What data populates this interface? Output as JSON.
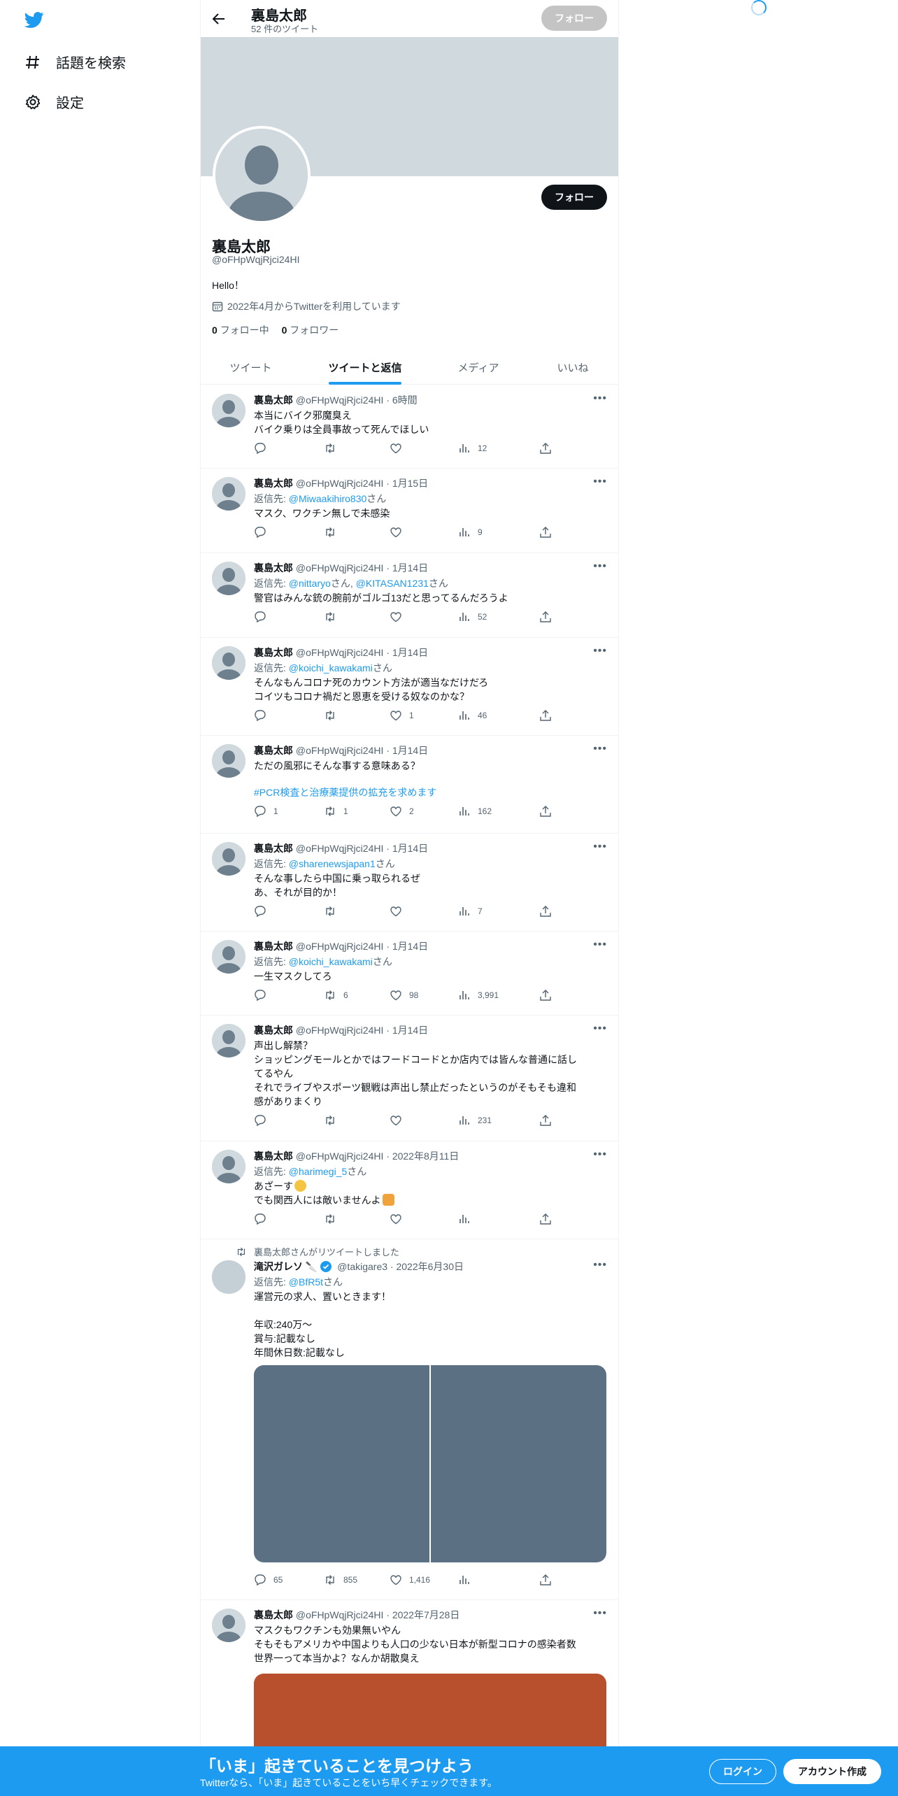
{
  "nav": {
    "items": [
      {
        "label": "話題を検索",
        "icon": "hashtag-icon"
      },
      {
        "label": "設定",
        "icon": "gear-icon"
      }
    ]
  },
  "topbar": {
    "name": "裏島太郎",
    "tweet_count": "52 件のツイート",
    "follow_label": "フォロー"
  },
  "profile": {
    "name": "裏島太郎",
    "handle": "@oFHpWqjRjci24HI",
    "bio": "Hello！",
    "joined": "2022年4月からTwitterを利用しています",
    "following_count": "0",
    "following_label": "フォロー中",
    "followers_count": "0",
    "followers_label": "フォロワー",
    "follow_label": "フォロー"
  },
  "tabs": [
    {
      "label": "ツイート"
    },
    {
      "label": "ツイートと返信"
    },
    {
      "label": "メディア"
    },
    {
      "label": "いいね"
    }
  ],
  "tweets": [
    {
      "name": "裏島太郎",
      "handle": "@oFHpWqjRjci24HI",
      "time": "6時間",
      "lines": [
        "本当にバイク邪魔臭え",
        "バイク乗りは全員事故って死んでほしい"
      ],
      "replies": "",
      "retweets": "",
      "likes": "",
      "views": "12"
    },
    {
      "name": "裏島太郎",
      "handle": "@oFHpWqjRjci24HI",
      "time": "1月15日",
      "reply_prefix": "返信先: ",
      "reply_to": "@Miwaakihiro830",
      "reply_suffix": "さん",
      "lines": [
        "マスク、ワクチン無しで未感染"
      ],
      "views": "9"
    },
    {
      "name": "裏島太郎",
      "handle": "@oFHpWqjRjci24HI",
      "time": "1月14日",
      "reply_prefix": "返信先: ",
      "reply_to": "@nittaryo",
      "reply_mid": "さん, ",
      "reply_to2": "@KITASAN1231",
      "reply_suffix": "さん",
      "lines": [
        "警官はみんな銃の腕前がゴルゴ13だと思ってるんだろうよ"
      ],
      "views": "52"
    },
    {
      "name": "裏島太郎",
      "handle": "@oFHpWqjRjci24HI",
      "time": "1月14日",
      "reply_prefix": "返信先: ",
      "reply_to": "@koichi_kawakami",
      "reply_suffix": "さん",
      "lines": [
        "そんなもんコロナ死のカウント方法が適当なだけだろ",
        "コイツもコロナ禍だと恩恵を受ける奴なのかな？"
      ],
      "likes": "1",
      "views": "46"
    },
    {
      "name": "裏島太郎",
      "handle": "@oFHpWqjRjci24HI",
      "time": "1月14日",
      "lines": [
        "ただの風邪にそんな事する意味ある？"
      ],
      "hashtag": "#PCR検査と治療薬提供の拡充を求めます",
      "replies": "1",
      "retweets": "1",
      "likes": "2",
      "views": "162"
    },
    {
      "name": "裏島太郎",
      "handle": "@oFHpWqjRjci24HI",
      "time": "1月14日",
      "reply_prefix": "返信先: ",
      "reply_to": "@sharenewsjapan1",
      "reply_suffix": "さん",
      "lines": [
        "そんな事したら中国に乗っ取られるぜ",
        "あ、それが目的か！"
      ],
      "views": "7"
    },
    {
      "name": "裏島太郎",
      "handle": "@oFHpWqjRjci24HI",
      "time": "1月14日",
      "reply_prefix": "返信先: ",
      "reply_to": "@koichi_kawakami",
      "reply_suffix": "さん",
      "lines": [
        "一生マスクしてろ"
      ],
      "retweets": "6",
      "likes": "98",
      "views": "3,991"
    },
    {
      "name": "裏島太郎",
      "handle": "@oFHpWqjRjci24HI",
      "time": "1月14日",
      "lines": [
        "声出し解禁？",
        "ショッピングモールとかではフードコードとか店内では皆んな普通に話し",
        "てるやん",
        "それでライブやスポーツ観戦は声出し禁止だったというのがそもそも違和",
        "感がありまくり"
      ],
      "views": "231"
    },
    {
      "name": "裏島太郎",
      "handle": "@oFHpWqjRjci24HI",
      "time": "2022年8月11日",
      "reply_prefix": "返信先: ",
      "reply_to": "@harimegi_5",
      "reply_suffix": "さん",
      "lines": [
        "あざーす",
        "でも関西人には敵いませんよ"
      ],
      "views": ""
    },
    {
      "retweet_label": "裏島太郎さんがリツイートしました",
      "name": "滝沢ガレソ",
      "handle": "@takigare3",
      "time": "2022年6月30日",
      "reply_prefix": "返信先: ",
      "reply_to": "@BfR5t",
      "reply_suffix": "さん",
      "lines": [
        "運営元の求人、置いときます！",
        "",
        "年収:240万〜",
        "賞与:記載なし",
        "年間休日数:記載なし"
      ],
      "replies": "65",
      "retweets": "855",
      "likes": "1,416",
      "views": ""
    },
    {
      "name": "裏島太郎",
      "handle": "@oFHpWqjRjci24HI",
      "time": "2022年7月28日",
      "lines": [
        "マスクもワクチンも効果無いやん",
        "そもそもアメリカや中国よりも人口の少ない日本が新型コロナの感染者数",
        "世界一って本当かよ？なんか胡散臭え"
      ]
    }
  ],
  "bottom": {
    "title": "「いま」起きていることを見つけよう",
    "subtitle": "Twitterなら、「いま」起きていることをいち早くチェックできます。",
    "login": "ログイン",
    "signup": "アカウント作成"
  },
  "colors": {
    "accent": "#1d9bf0",
    "banner": "#cfd9de",
    "media": "#5b7083",
    "second_media": "#b9502d"
  }
}
